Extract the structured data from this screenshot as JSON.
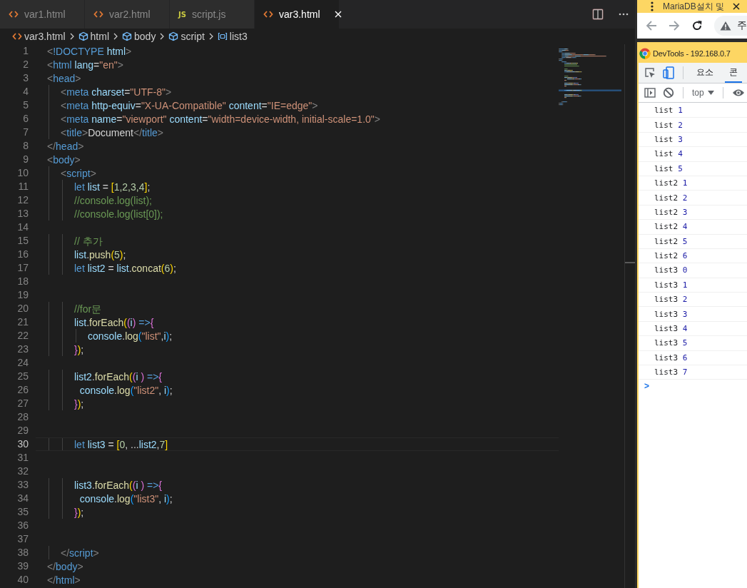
{
  "editor_tabs": [
    {
      "label": "var1.html",
      "kind": "html",
      "selected": false
    },
    {
      "label": "var2.html",
      "kind": "html",
      "selected": false
    },
    {
      "label": "script.js",
      "kind": "js",
      "badge": "JS",
      "selected": false
    },
    {
      "label": "var3.html",
      "kind": "html",
      "selected": true
    }
  ],
  "breadcrumbs": [
    {
      "kind": "file",
      "label": "var3.html"
    },
    {
      "kind": "element",
      "label": "html"
    },
    {
      "kind": "element",
      "label": "body"
    },
    {
      "kind": "element",
      "label": "script"
    },
    {
      "kind": "variable",
      "label": "list3"
    }
  ],
  "editor": {
    "lines": [
      {
        "number": "1",
        "current": false,
        "tokens": [
          {
            "kind": "p",
            "text": "<"
          },
          {
            "kind": "tag",
            "text": "!DOCTYPE"
          },
          {
            "kind": "attr",
            "text": " html"
          },
          {
            "kind": "p",
            "text": ">"
          }
        ]
      },
      {
        "number": "2",
        "current": false,
        "tokens": [
          {
            "kind": "p",
            "text": "<"
          },
          {
            "kind": "tag",
            "text": "html"
          },
          {
            "kind": "attr",
            "text": " lang"
          },
          {
            "kind": "txt",
            "text": "="
          },
          {
            "kind": "str",
            "text": "\"en\""
          },
          {
            "kind": "p",
            "text": ">"
          }
        ]
      },
      {
        "number": "3",
        "current": false,
        "tokens": [
          {
            "kind": "p",
            "text": "<"
          },
          {
            "kind": "tag",
            "text": "head"
          },
          {
            "kind": "p",
            "text": ">"
          }
        ]
      },
      {
        "number": "4",
        "current": false,
        "tokens": [
          {
            "kind": "p",
            "text": "\t<"
          },
          {
            "kind": "tag",
            "text": "meta"
          },
          {
            "kind": "attr",
            "text": " charset"
          },
          {
            "kind": "txt",
            "text": "="
          },
          {
            "kind": "str",
            "text": "\"UTF-8\""
          },
          {
            "kind": "p",
            "text": ">"
          }
        ]
      },
      {
        "number": "5",
        "current": false,
        "tokens": [
          {
            "kind": "p",
            "text": "\t<"
          },
          {
            "kind": "tag",
            "text": "meta"
          },
          {
            "kind": "attr",
            "text": " http-equiv"
          },
          {
            "kind": "txt",
            "text": "="
          },
          {
            "kind": "str",
            "text": "\"X-UA-Compatible\""
          },
          {
            "kind": "attr",
            "text": " content"
          },
          {
            "kind": "txt",
            "text": "="
          },
          {
            "kind": "str",
            "text": "\"IE=edge\""
          },
          {
            "kind": "p",
            "text": ">"
          }
        ]
      },
      {
        "number": "6",
        "current": false,
        "tokens": [
          {
            "kind": "p",
            "text": "\t<"
          },
          {
            "kind": "tag",
            "text": "meta"
          },
          {
            "kind": "attr",
            "text": " name"
          },
          {
            "kind": "txt",
            "text": "="
          },
          {
            "kind": "str",
            "text": "\"viewport\""
          },
          {
            "kind": "attr",
            "text": " content"
          },
          {
            "kind": "txt",
            "text": "="
          },
          {
            "kind": "str",
            "text": "\"width=device-width, initial-scale=1.0\""
          },
          {
            "kind": "p",
            "text": ">"
          }
        ]
      },
      {
        "number": "7",
        "current": false,
        "tokens": [
          {
            "kind": "p",
            "text": "\t<"
          },
          {
            "kind": "tag",
            "text": "title"
          },
          {
            "kind": "p",
            "text": ">"
          },
          {
            "kind": "txt",
            "text": "Document"
          },
          {
            "kind": "p",
            "text": "</"
          },
          {
            "kind": "tag",
            "text": "title"
          },
          {
            "kind": "p",
            "text": ">"
          }
        ]
      },
      {
        "number": "8",
        "current": false,
        "tokens": [
          {
            "kind": "p",
            "text": "</"
          },
          {
            "kind": "tag",
            "text": "head"
          },
          {
            "kind": "p",
            "text": ">"
          }
        ]
      },
      {
        "number": "9",
        "current": false,
        "tokens": [
          {
            "kind": "p",
            "text": "<"
          },
          {
            "kind": "tag",
            "text": "body"
          },
          {
            "kind": "p",
            "text": ">"
          }
        ]
      },
      {
        "number": "10",
        "current": false,
        "tokens": [
          {
            "kind": "p",
            "text": "\t<"
          },
          {
            "kind": "tag",
            "text": "script"
          },
          {
            "kind": "p",
            "text": ">"
          }
        ]
      },
      {
        "number": "11",
        "current": false,
        "tokens": [
          {
            "kind": "kw",
            "text": "\t\tlet"
          },
          {
            "kind": "var",
            "text": " list"
          },
          {
            "kind": "txt",
            "text": " = "
          },
          {
            "kind": "b1",
            "text": "["
          },
          {
            "kind": "num",
            "text": "1,2,3,4"
          },
          {
            "kind": "b1",
            "text": "]"
          },
          {
            "kind": "txt",
            "text": ";"
          }
        ]
      },
      {
        "number": "12",
        "current": false,
        "tokens": [
          {
            "kind": "cmt",
            "text": "\t\t//console.log(list);"
          }
        ]
      },
      {
        "number": "13",
        "current": false,
        "tokens": [
          {
            "kind": "cmt",
            "text": "\t\t//console.log(list[0]);"
          }
        ]
      },
      {
        "number": "14",
        "current": false
      },
      {
        "number": "15",
        "current": false,
        "tokens": [
          {
            "kind": "cmt",
            "text": "\t\t// 추가"
          }
        ]
      },
      {
        "number": "16",
        "current": false,
        "tokens": [
          {
            "kind": "var",
            "text": "\t\tlist"
          },
          {
            "kind": "txt",
            "text": "."
          },
          {
            "kind": "fn",
            "text": "push"
          },
          {
            "kind": "b1",
            "text": "("
          },
          {
            "kind": "num",
            "text": "5"
          },
          {
            "kind": "b1",
            "text": ")"
          },
          {
            "kind": "txt",
            "text": ";"
          }
        ]
      },
      {
        "number": "17",
        "current": false,
        "tokens": [
          {
            "kind": "kw",
            "text": "\t\tlet"
          },
          {
            "kind": "var",
            "text": " list2"
          },
          {
            "kind": "txt",
            "text": " = "
          },
          {
            "kind": "var",
            "text": "list"
          },
          {
            "kind": "txt",
            "text": "."
          },
          {
            "kind": "fn",
            "text": "concat"
          },
          {
            "kind": "b1",
            "text": "("
          },
          {
            "kind": "num",
            "text": "6"
          },
          {
            "kind": "b1",
            "text": ")"
          },
          {
            "kind": "txt",
            "text": ";"
          }
        ]
      },
      {
        "number": "18",
        "current": false
      },
      {
        "number": "19",
        "current": false
      },
      {
        "number": "20",
        "current": false,
        "tokens": [
          {
            "kind": "cmt",
            "text": "\t\t//for문"
          }
        ]
      },
      {
        "number": "21",
        "current": false,
        "tokens": [
          {
            "kind": "var",
            "text": "\t\tlist"
          },
          {
            "kind": "txt",
            "text": "."
          },
          {
            "kind": "fn",
            "text": "forEach"
          },
          {
            "kind": "b1",
            "text": "("
          },
          {
            "kind": "b2",
            "text": "("
          },
          {
            "kind": "var",
            "text": "i"
          },
          {
            "kind": "b2",
            "text": ")"
          },
          {
            "kind": "kw",
            "text": " =>"
          },
          {
            "kind": "b2",
            "text": "{"
          }
        ]
      },
      {
        "number": "22",
        "current": false,
        "tokens": [
          {
            "kind": "var",
            "text": "\t\t\tconsole"
          },
          {
            "kind": "txt",
            "text": "."
          },
          {
            "kind": "fn",
            "text": "log"
          },
          {
            "kind": "b3",
            "text": "("
          },
          {
            "kind": "str",
            "text": "\"list\""
          },
          {
            "kind": "txt",
            "text": ","
          },
          {
            "kind": "var",
            "text": "i"
          },
          {
            "kind": "b3",
            "text": ")"
          },
          {
            "kind": "txt",
            "text": ";"
          }
        ]
      },
      {
        "number": "23",
        "current": false,
        "tokens": [
          {
            "kind": "b2",
            "text": "\t\t}"
          },
          {
            "kind": "b1",
            "text": ")"
          },
          {
            "kind": "txt",
            "text": ";"
          }
        ]
      },
      {
        "number": "24",
        "current": false
      },
      {
        "number": "25",
        "current": false,
        "tokens": [
          {
            "kind": "var",
            "text": "\t\tlist2"
          },
          {
            "kind": "txt",
            "text": "."
          },
          {
            "kind": "fn",
            "text": "forEach"
          },
          {
            "kind": "b1",
            "text": "("
          },
          {
            "kind": "b2",
            "text": "("
          },
          {
            "kind": "var",
            "text": "i "
          },
          {
            "kind": "b2",
            "text": ")"
          },
          {
            "kind": "kw",
            "text": " =>"
          },
          {
            "kind": "b2",
            "text": "{"
          }
        ]
      },
      {
        "number": "26",
        "current": false,
        "tokens": [
          {
            "kind": "var",
            "text": "\t\t  console"
          },
          {
            "kind": "txt",
            "text": "."
          },
          {
            "kind": "fn",
            "text": "log"
          },
          {
            "kind": "b3",
            "text": "("
          },
          {
            "kind": "str",
            "text": "\"list2\""
          },
          {
            "kind": "txt",
            "text": ", "
          },
          {
            "kind": "var",
            "text": "i"
          },
          {
            "kind": "b3",
            "text": ")"
          },
          {
            "kind": "txt",
            "text": ";"
          }
        ]
      },
      {
        "number": "27",
        "current": false,
        "tokens": [
          {
            "kind": "b2",
            "text": "\t\t}"
          },
          {
            "kind": "b1",
            "text": ")"
          },
          {
            "kind": "txt",
            "text": ";"
          }
        ]
      },
      {
        "number": "28",
        "current": false
      },
      {
        "number": "29",
        "current": false
      },
      {
        "number": "30",
        "current": true,
        "tokens": [
          {
            "kind": "kw",
            "text": "\t\tlet"
          },
          {
            "kind": "var",
            "text": " list3"
          },
          {
            "kind": "txt",
            "text": " = "
          },
          {
            "kind": "b1",
            "text": "["
          },
          {
            "kind": "num",
            "text": "0"
          },
          {
            "kind": "txt",
            "text": ", ..."
          },
          {
            "kind": "var",
            "text": "list2"
          },
          {
            "kind": "txt",
            "text": ","
          },
          {
            "kind": "num",
            "text": "7"
          },
          {
            "kind": "b1",
            "text": "]"
          }
        ]
      },
      {
        "number": "31",
        "current": false
      },
      {
        "number": "32",
        "current": false
      },
      {
        "number": "33",
        "current": false,
        "tokens": [
          {
            "kind": "var",
            "text": "\t\tlist3"
          },
          {
            "kind": "txt",
            "text": "."
          },
          {
            "kind": "fn",
            "text": "forEach"
          },
          {
            "kind": "b1",
            "text": "("
          },
          {
            "kind": "b2",
            "text": "("
          },
          {
            "kind": "var",
            "text": "i "
          },
          {
            "kind": "b2",
            "text": ")"
          },
          {
            "kind": "kw",
            "text": " =>"
          },
          {
            "kind": "b2",
            "text": "{"
          }
        ]
      },
      {
        "number": "34",
        "current": false,
        "tokens": [
          {
            "kind": "var",
            "text": "\t\t  console"
          },
          {
            "kind": "txt",
            "text": "."
          },
          {
            "kind": "fn",
            "text": "log"
          },
          {
            "kind": "b3",
            "text": "("
          },
          {
            "kind": "str",
            "text": "\"list3\""
          },
          {
            "kind": "txt",
            "text": ", "
          },
          {
            "kind": "var",
            "text": "i"
          },
          {
            "kind": "b3",
            "text": ")"
          },
          {
            "kind": "txt",
            "text": ";"
          }
        ]
      },
      {
        "number": "35",
        "current": false,
        "tokens": [
          {
            "kind": "b2",
            "text": "\t\t}"
          },
          {
            "kind": "b1",
            "text": ")"
          },
          {
            "kind": "txt",
            "text": ";"
          }
        ]
      },
      {
        "number": "36",
        "current": false
      },
      {
        "number": "37",
        "current": false
      },
      {
        "number": "38",
        "current": false,
        "tokens": [
          {
            "kind": "p",
            "text": "\t</"
          },
          {
            "kind": "tag",
            "text": "script"
          },
          {
            "kind": "p",
            "text": ">"
          }
        ]
      },
      {
        "number": "39",
        "current": false,
        "tokens": [
          {
            "kind": "p",
            "text": "</"
          },
          {
            "kind": "tag",
            "text": "body"
          },
          {
            "kind": "p",
            "text": ">"
          }
        ]
      },
      {
        "number": "40",
        "current": false,
        "tokens": [
          {
            "kind": "p",
            "text": "</"
          },
          {
            "kind": "tag",
            "text": "html"
          },
          {
            "kind": "p",
            "text": ">"
          }
        ]
      }
    ]
  },
  "browser": {
    "tab_title": "MariaDB설치 및",
    "address": "주"
  },
  "devtools": {
    "title": "DevTools - 192.168.0.7",
    "tabs": [
      {
        "label": "요소",
        "selected": false
      },
      {
        "label": "콘",
        "selected": true
      }
    ],
    "context": "top",
    "messages": [
      {
        "label": "list",
        "value": "1"
      },
      {
        "label": "list",
        "value": "2"
      },
      {
        "label": "list",
        "value": "3"
      },
      {
        "label": "list",
        "value": "4"
      },
      {
        "label": "list",
        "value": "5"
      },
      {
        "label": "list2",
        "value": "1"
      },
      {
        "label": "list2",
        "value": "2"
      },
      {
        "label": "list2",
        "value": "3"
      },
      {
        "label": "list2",
        "value": "4"
      },
      {
        "label": "list2",
        "value": "5"
      },
      {
        "label": "list2",
        "value": "6"
      },
      {
        "label": "list3",
        "value": "0"
      },
      {
        "label": "list3",
        "value": "1"
      },
      {
        "label": "list3",
        "value": "2"
      },
      {
        "label": "list3",
        "value": "3"
      },
      {
        "label": "list3",
        "value": "4"
      },
      {
        "label": "list3",
        "value": "5"
      },
      {
        "label": "list3",
        "value": "6"
      },
      {
        "label": "list3",
        "value": "7"
      }
    ],
    "prompt": ">"
  }
}
